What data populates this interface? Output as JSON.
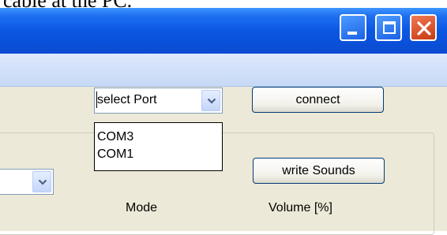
{
  "document": {
    "text_above": "cable at the PC."
  },
  "titlebar": {
    "buttons": {
      "minimize": "minimize-icon",
      "maximize": "maximize-icon",
      "close": "close-icon"
    },
    "colors": {
      "title_blue": "#0b57e3",
      "close_red": "#c83a12"
    }
  },
  "port": {
    "select_value": "select Port",
    "options": [
      "COM3",
      "COM1"
    ],
    "connect_label": "connect"
  },
  "sounds": {
    "write_label": "write Sounds"
  },
  "table": {
    "headers": [
      "Mode",
      "Volume [%]"
    ]
  }
}
